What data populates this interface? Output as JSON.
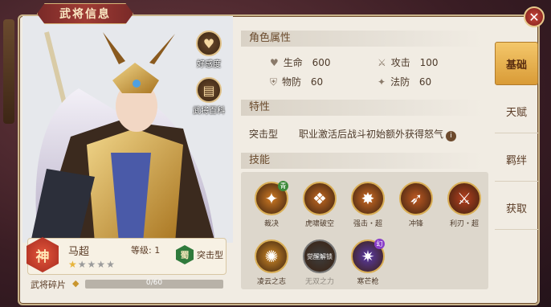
{
  "window": {
    "title": "武将信息"
  },
  "side_buttons": [
    {
      "label": "好感度",
      "icon": "heart-icon"
    },
    {
      "label": "武将百科",
      "icon": "book-icon"
    }
  ],
  "hero": {
    "tier_badge": "神",
    "name": "马超",
    "level_text": "等级: 1",
    "stars_filled": 1,
    "stars_total": 5,
    "faction_badge": "蜀",
    "role": "突击型"
  },
  "shards": {
    "label": "武将碎片",
    "current": 0,
    "max": 60,
    "text": "0/60"
  },
  "attributes": {
    "heading": "角色属性",
    "items": [
      {
        "label": "生命",
        "value": "600",
        "icon": "heart-icon"
      },
      {
        "label": "攻击",
        "value": "100",
        "icon": "sword-icon"
      },
      {
        "label": "物防",
        "value": "60",
        "icon": "shield-icon"
      },
      {
        "label": "法防",
        "value": "60",
        "icon": "magic-shield-icon"
      }
    ]
  },
  "traits": {
    "heading": "特性",
    "type": "突击型",
    "description": "职业激活后战斗初始额外获得怒气"
  },
  "skills": {
    "heading": "技能",
    "items": [
      {
        "name": "裁决",
        "tag": "青",
        "tag_color": "#3d8a3a",
        "color": "#d07a23",
        "locked": false
      },
      {
        "name": "虎啸破空",
        "tag": "",
        "tag_color": "#3a6bbf",
        "color": "#c46a22",
        "locked": false
      },
      {
        "name": "强击・超",
        "tag": "",
        "tag_color": "#3a6bbf",
        "color": "#cf6c24",
        "locked": false
      },
      {
        "name": "冲锋",
        "tag": "",
        "tag_color": "#3a6bbf",
        "color": "#c05a22",
        "locked": false
      },
      {
        "name": "利刃・超",
        "tag": "",
        "tag_color": "#3a6bbf",
        "color": "#b8401f",
        "locked": false
      },
      {
        "name": "凌云之志",
        "tag": "",
        "tag_color": "#3a6bbf",
        "color": "#d08a27",
        "locked": false
      },
      {
        "name": "无双之力",
        "tag": "",
        "tag_color": "#3a6bbf",
        "color": "#3e3e3e",
        "locked": true,
        "lock_text": "觉醒解锁"
      },
      {
        "name": "寒芒枪",
        "tag": "幻",
        "tag_color": "#8a3fc9",
        "color": "#5b3aa8",
        "locked": false
      }
    ]
  },
  "tabs": [
    {
      "label": "基础",
      "active": true
    },
    {
      "label": "天赋",
      "active": false
    },
    {
      "label": "羁绊",
      "active": false
    },
    {
      "label": "获取",
      "active": false
    }
  ]
}
